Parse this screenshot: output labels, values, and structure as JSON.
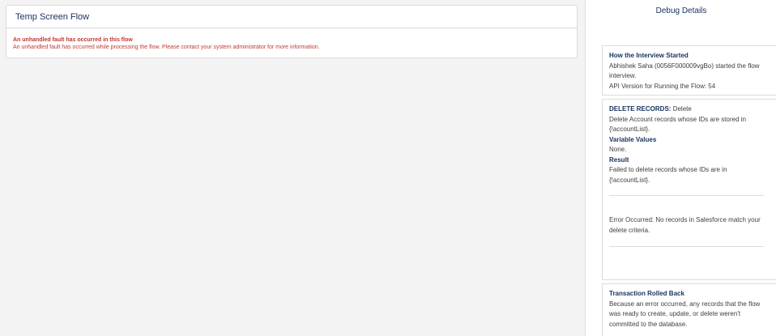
{
  "flow": {
    "title": "Temp Screen Flow",
    "error_title": "An unhandled fault has occurred in this flow",
    "error_message": "An unhandled fault has occurred while processing the flow. Please contact your system administrator for more information."
  },
  "debug": {
    "title": "Debug Details",
    "started": {
      "heading": "How the Interview Started",
      "line1": "Abhishek Saha (0056F000009vgBo) started the flow",
      "line2": "interview.",
      "api_version": "API Version for Running the Flow: 54"
    },
    "delete": {
      "label": "DELETE RECORDS:",
      "value": "Delete",
      "desc1": "Delete Account records whose IDs are stored in",
      "desc2": "{!accountList}.",
      "var_heading": "Variable Values",
      "var_value": "None.",
      "result_heading": "Result",
      "result1": "Failed to delete records whose IDs are in",
      "result2": "{!accountList}.",
      "error1": "Error Occurred: No records in Salesforce match your",
      "error2": "delete criteria."
    },
    "rollback": {
      "heading": "Transaction Rolled Back",
      "line1": "Because an error occurred, any records that the flow",
      "line2": "was ready to create, update, or delete weren't",
      "line3": "committed to the database."
    }
  }
}
